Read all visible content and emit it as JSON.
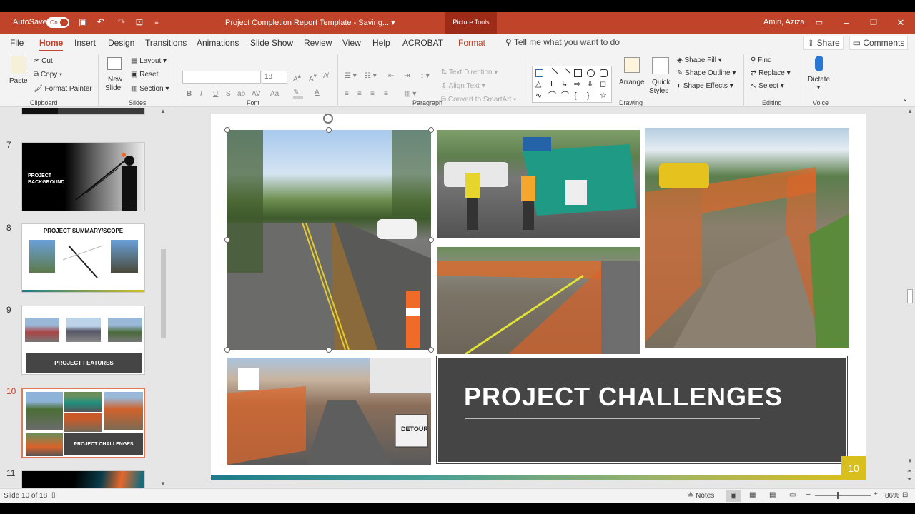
{
  "titlebar": {
    "autosave_label": "AutoSave",
    "autosave_state": "On",
    "document_title": "Project Completion Report Template  -  Saving...  ▾",
    "picture_tools": "Picture Tools",
    "user_name": "Amiri, Aziza"
  },
  "tabs": [
    "File",
    "Home",
    "Insert",
    "Design",
    "Transitions",
    "Animations",
    "Slide Show",
    "Review",
    "View",
    "Help",
    "ACROBAT",
    "Format"
  ],
  "search_placeholder": "Tell me what you want to do",
  "share_label": "Share",
  "comments_label": "Comments",
  "ribbon": {
    "clipboard": {
      "paste": "Paste",
      "cut": "Cut",
      "copy": "Copy",
      "format_painter": "Format Painter",
      "label": "Clipboard"
    },
    "slides": {
      "new_slide": "New",
      "new_slide2": "Slide",
      "layout": "Layout",
      "reset": "Reset",
      "section": "Section",
      "label": "Slides"
    },
    "font": {
      "font_size": "18",
      "label": "Font",
      "bold": "B",
      "italic": "I",
      "underline": "U",
      "strike": "S",
      "shadow": "ab",
      "spacing": "AV",
      "case": "Aa",
      "color": "A"
    },
    "paragraph": {
      "text_direction": "Text Direction",
      "align_text": "Align Text",
      "convert_smartart": "Convert to SmartArt",
      "label": "Paragraph"
    },
    "drawing": {
      "arrange": "Arrange",
      "quick_styles": "Quick",
      "quick_styles2": "Styles",
      "shape_fill": "Shape Fill",
      "shape_outline": "Shape Outline",
      "shape_effects": "Shape Effects",
      "label": "Drawing"
    },
    "editing": {
      "find": "Find",
      "replace": "Replace",
      "select": "Select",
      "label": "Editing"
    },
    "voice": {
      "dictate": "Dictate",
      "label": "Voice"
    }
  },
  "thumbnails": [
    {
      "num": "7",
      "title": "PROJECT\nBACKGROUND"
    },
    {
      "num": "8",
      "title": "PROJECT SUMMARY/SCOPE"
    },
    {
      "num": "9",
      "title": "PROJECT FEATURES"
    },
    {
      "num": "10",
      "title": "PROJECT CHALLENGES",
      "selected": true
    },
    {
      "num": "11",
      "title": ""
    }
  ],
  "slide": {
    "title": "PROJECT CHALLENGES",
    "page_number": "10",
    "detour_sign": "DETOUR"
  },
  "status": {
    "slide_info": "Slide 10 of 18",
    "notes": "Notes",
    "zoom": "86%"
  }
}
